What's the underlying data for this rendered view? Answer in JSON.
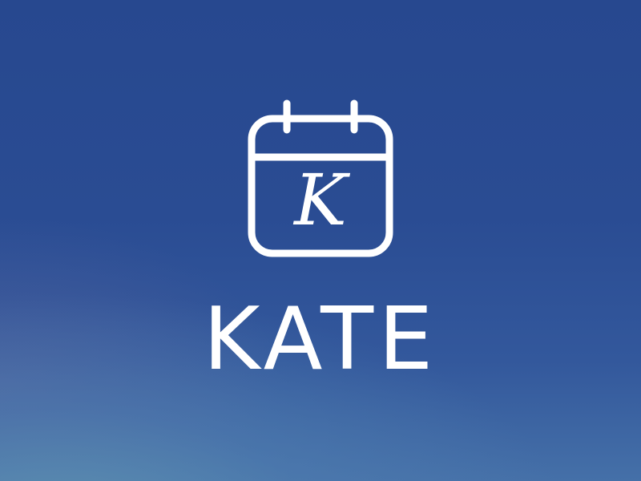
{
  "splash": {
    "app_name": "KATE",
    "logo_letter": "K",
    "logo_icon": "calendar-icon",
    "colors": {
      "background_top": "#27488f",
      "background_bottom": "#4570a8",
      "foreground": "#ffffff"
    }
  }
}
